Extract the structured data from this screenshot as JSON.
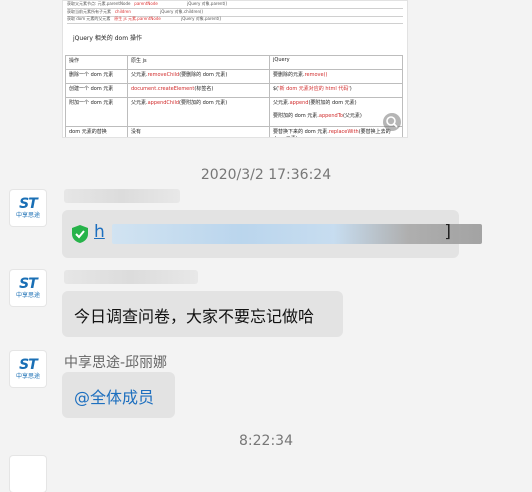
{
  "doc_image": {
    "top_rows": [
      {
        "a": "获取父元素节点: 元素.parentNode",
        "b": "",
        "c": "jQuery 对象.parent()",
        "d": "",
        "red": "parentNode"
      },
      {
        "a": "获取当前元素所有子元素",
        "b": "元素.children",
        "c": "jQuery 对象.children()",
        "d": "",
        "red": "children"
      },
      {
        "a": "获取 dom 元素的父元素",
        "b": "原生 js 元素.parentNode",
        "c": "jQuery 对象.parent()",
        "d": "",
        "red": "parent()"
      }
    ],
    "heading": "jQuery 相关的 dom 操作",
    "table_header": [
      "操作",
      "原生 js",
      "jQuery"
    ],
    "table_rows": [
      {
        "op": "删除一个 dom 元素",
        "js_pre": "父元素.",
        "js_hl": "removeChild",
        "js_post": "(要删除的 dom 元素)",
        "jq_pre": "要删除的元素.",
        "jq_hl": "remove()",
        "jq_post": ""
      },
      {
        "op": "创建一个 dom 元素",
        "js_pre": "",
        "js_hl": "document.createElement",
        "js_post": "(标签名)",
        "jq_pre": "$(",
        "jq_hl": "'新 dom 元素对应的 html 代码'",
        "jq_post": ")"
      },
      {
        "op": "附加一个 dom 元素",
        "js_pre": "父元素.",
        "js_hl": "appendChild",
        "js_post": "(要附加的 dom 元素)",
        "jq_pre": "父元素.",
        "jq_hl": "append",
        "jq_post": "(要附加的 dom 元素)",
        "jq2_pre": "要附加的 dom 元素.",
        "jq2_hl": "appendTo",
        "jq2_post": "(父元素)"
      },
      {
        "op": "dom 元素的替换",
        "js_pre": "没有",
        "js_hl": "",
        "js_post": "",
        "jq_pre": "要替换下来的 dom 元素.",
        "jq_hl": "replaceWith",
        "jq_post": "(要替换上去的 dom 元素)"
      }
    ]
  },
  "timestamps": {
    "first": "2020/3/2 17:36:24",
    "second": "8:22:34"
  },
  "avatar": {
    "mark": "ST",
    "sub": "中享思途"
  },
  "messages": {
    "link": {
      "prefix": "h",
      "suffix": "]"
    },
    "notice": {
      "text": "今日调查问卷，大家不要忘记做哈"
    },
    "mention": {
      "sender": "中享思途-邱丽娜",
      "text": "@全体成员"
    }
  },
  "colors": {
    "link": "#1d6fbf",
    "bubble": "#e3e3e3",
    "background": "#f3f3f3",
    "highlight": "#d12b2b"
  },
  "icons": {
    "shield": "green-shield-check-icon",
    "zoom": "magnify-icon"
  }
}
